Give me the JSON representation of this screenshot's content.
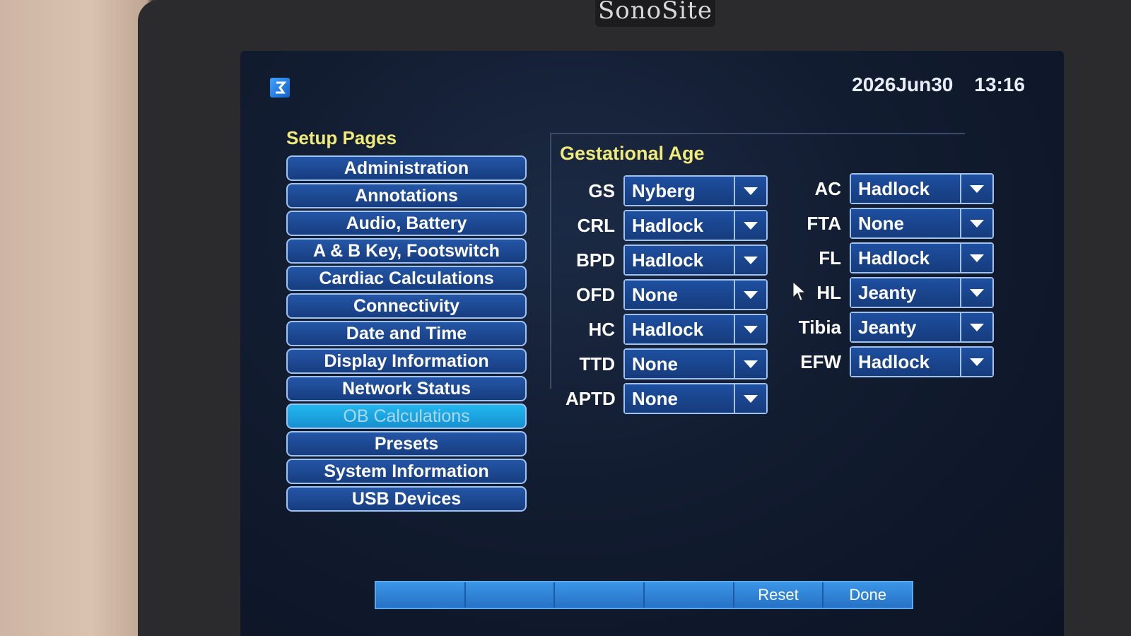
{
  "device": {
    "brand": "SonoSite"
  },
  "header": {
    "date": "2026Jun30",
    "time": "13:16"
  },
  "setup_pages": {
    "title": "Setup Pages",
    "items": [
      {
        "label": "Administration",
        "active": false
      },
      {
        "label": "Annotations",
        "active": false
      },
      {
        "label": "Audio, Battery",
        "active": false
      },
      {
        "label": "A & B Key, Footswitch",
        "active": false
      },
      {
        "label": "Cardiac Calculations",
        "active": false
      },
      {
        "label": "Connectivity",
        "active": false
      },
      {
        "label": "Date and Time",
        "active": false
      },
      {
        "label": "Display Information",
        "active": false
      },
      {
        "label": "Network Status",
        "active": false
      },
      {
        "label": "OB Calculations",
        "active": true
      },
      {
        "label": "Presets",
        "active": false
      },
      {
        "label": "System Information",
        "active": false
      },
      {
        "label": "USB Devices",
        "active": false
      }
    ]
  },
  "gestational_age": {
    "title": "Gestational Age",
    "left": [
      {
        "label": "GS",
        "value": "Nyberg"
      },
      {
        "label": "CRL",
        "value": "Hadlock"
      },
      {
        "label": "BPD",
        "value": "Hadlock"
      },
      {
        "label": "OFD",
        "value": "None"
      },
      {
        "label": "HC",
        "value": "Hadlock"
      },
      {
        "label": "TTD",
        "value": "None"
      },
      {
        "label": "APTD",
        "value": "None"
      }
    ],
    "right": [
      {
        "label": "AC",
        "value": "Hadlock"
      },
      {
        "label": "FTA",
        "value": "None"
      },
      {
        "label": "FL",
        "value": "Hadlock"
      },
      {
        "label": "HL",
        "value": "Jeanty"
      },
      {
        "label": "Tibia",
        "value": "Jeanty"
      },
      {
        "label": "EFW",
        "value": "Hadlock"
      }
    ]
  },
  "softkeys": [
    "",
    "",
    "",
    "",
    "Reset",
    "Done"
  ],
  "colors": {
    "accent_yellow": "#f0ea7a",
    "button_blue": "#173d80",
    "active_cyan": "#22b8f0"
  }
}
